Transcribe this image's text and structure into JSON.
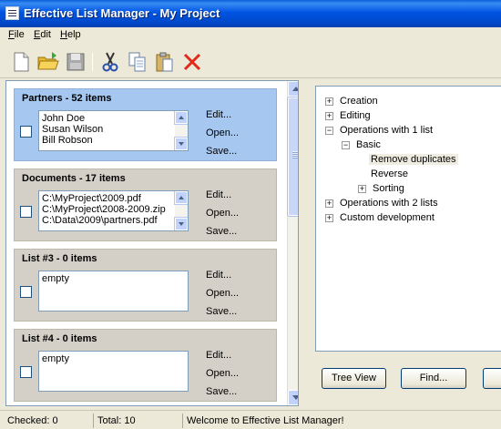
{
  "window": {
    "title": "Effective List Manager - My Project"
  },
  "menu": {
    "items": [
      "File",
      "Edit",
      "Help"
    ]
  },
  "toolbar": {
    "buttons": [
      "new-file-icon",
      "open-folder-icon",
      "save-icon",
      "cut-icon",
      "copy-icon",
      "paste-icon",
      "delete-icon"
    ]
  },
  "lists": [
    {
      "title": "Partners - 52 items",
      "items": [
        "John Doe",
        "Susan Wilson",
        "Bill Robson"
      ],
      "actions": [
        "Edit...",
        "Open...",
        "Save..."
      ],
      "selected": true
    },
    {
      "title": "Documents - 17 items",
      "items": [
        "C:\\MyProject\\2009.pdf",
        "C:\\MyProject\\2008-2009.zip",
        "C:\\Data\\2009\\partners.pdf"
      ],
      "actions": [
        "Edit...",
        "Open...",
        "Save..."
      ],
      "selected": false
    },
    {
      "title": "List #3 - 0 items",
      "items": [
        "empty"
      ],
      "actions": [
        "Edit...",
        "Open...",
        "Save..."
      ],
      "selected": false
    },
    {
      "title": "List #4 - 0 items",
      "items": [
        "empty"
      ],
      "actions": [
        "Edit...",
        "Open...",
        "Save..."
      ],
      "selected": false
    }
  ],
  "tree": {
    "nodes": [
      {
        "label": "Creation",
        "toggle": "+"
      },
      {
        "label": "Editing",
        "toggle": "+"
      },
      {
        "label": "Operations with 1 list",
        "toggle": "−"
      },
      {
        "label": "Basic",
        "toggle": "−"
      },
      {
        "label": "Remove duplicates",
        "toggle": ""
      },
      {
        "label": "Reverse",
        "toggle": ""
      },
      {
        "label": "Sorting",
        "toggle": "+"
      },
      {
        "label": "Operations with 2 lists",
        "toggle": "+"
      },
      {
        "label": "Custom development",
        "toggle": "+"
      }
    ]
  },
  "buttons": {
    "tree_view": "Tree View",
    "find": "Find..."
  },
  "status": {
    "checked": "Checked: 0",
    "total": "Total: 10",
    "message": "Welcome to Effective List Manager!"
  }
}
